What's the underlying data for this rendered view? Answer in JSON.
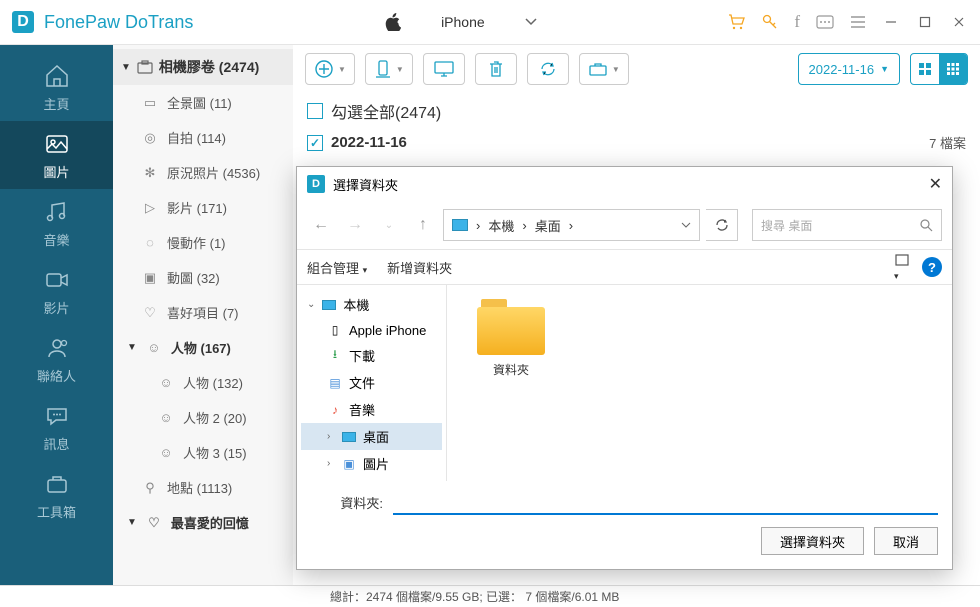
{
  "app": {
    "title": "FonePaw DoTrans"
  },
  "device": {
    "name": "iPhone"
  },
  "nav": [
    {
      "label": "主頁"
    },
    {
      "label": "圖片"
    },
    {
      "label": "音樂"
    },
    {
      "label": "影片"
    },
    {
      "label": "聯絡人"
    },
    {
      "label": "訊息"
    },
    {
      "label": "工具箱"
    }
  ],
  "albums": {
    "camera_roll": "相機膠卷 (2474)",
    "items": [
      {
        "label": "全景圖 (11)"
      },
      {
        "label": "自拍 (114)"
      },
      {
        "label": "原況照片 (4536)"
      },
      {
        "label": "影片 (171)"
      },
      {
        "label": "慢動作 (1)"
      },
      {
        "label": "動圖 (32)"
      },
      {
        "label": "喜好項目 (7)"
      }
    ],
    "people_header": "人物 (167)",
    "people": [
      {
        "label": "人物 (132)"
      },
      {
        "label": "人物 2 (20)"
      },
      {
        "label": "人物 3 (15)"
      }
    ],
    "places": "地點 (1113)",
    "memories": "最喜愛的回憶"
  },
  "content": {
    "date_filter": "2022-11-16",
    "select_all": "勾選全部(2474)",
    "group_date": "2022-11-16",
    "group_count": "7 檔案"
  },
  "status": "總計：2474 個檔案/9.55 GB; 已選： 7 個檔案/6.01 MB",
  "dialog": {
    "title": "選擇資料夾",
    "path_root": "本機",
    "path_leaf": "桌面",
    "search_placeholder": "搜尋 桌面",
    "organize": "組合管理",
    "new_folder": "新增資料夾",
    "tree": {
      "root": "本機",
      "children": [
        "Apple iPhone",
        "下載",
        "文件",
        "音樂",
        "桌面",
        "圖片"
      ]
    },
    "folder_name": "資料夾",
    "input_label": "資料夾:",
    "ok": "選擇資料夾",
    "cancel": "取消"
  }
}
